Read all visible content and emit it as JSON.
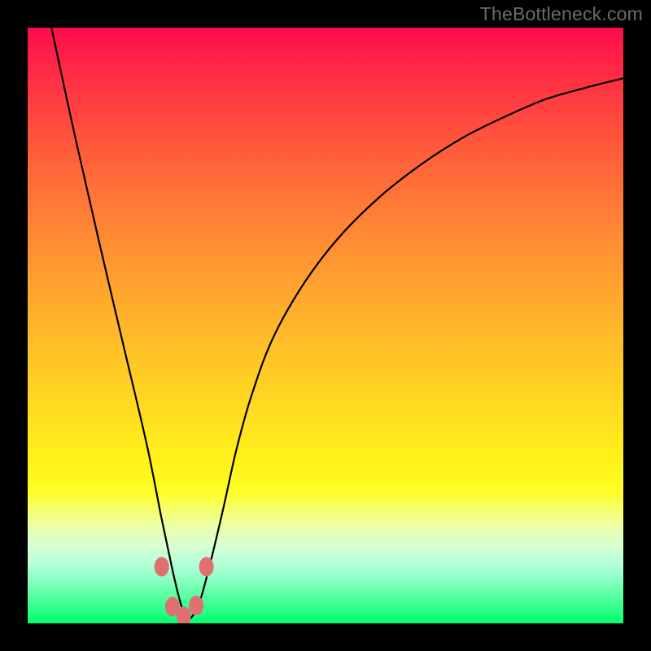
{
  "watermark": "TheBottleneck.com",
  "chart_data": {
    "type": "line",
    "title": "",
    "xlabel": "",
    "ylabel": "",
    "xlim": [
      0,
      1
    ],
    "ylim": [
      0,
      1
    ],
    "series": [
      {
        "name": "curve",
        "x": [
          0.04,
          0.08,
          0.12,
          0.16,
          0.2,
          0.225,
          0.243,
          0.255,
          0.265,
          0.275,
          0.29,
          0.31,
          0.33,
          0.35,
          0.375,
          0.41,
          0.46,
          0.52,
          0.59,
          0.66,
          0.73,
          0.8,
          0.87,
          0.94,
          1.0
        ],
        "y": [
          1.0,
          0.815,
          0.64,
          0.47,
          0.3,
          0.175,
          0.09,
          0.04,
          0.01,
          0.01,
          0.04,
          0.115,
          0.2,
          0.29,
          0.38,
          0.475,
          0.565,
          0.645,
          0.715,
          0.77,
          0.815,
          0.85,
          0.88,
          0.9,
          0.915
        ]
      }
    ],
    "markers": [
      {
        "x": 0.225,
        "y": 0.095
      },
      {
        "x": 0.243,
        "y": 0.028
      },
      {
        "x": 0.262,
        "y": 0.012
      },
      {
        "x": 0.283,
        "y": 0.03
      },
      {
        "x": 0.3,
        "y": 0.095
      }
    ]
  }
}
